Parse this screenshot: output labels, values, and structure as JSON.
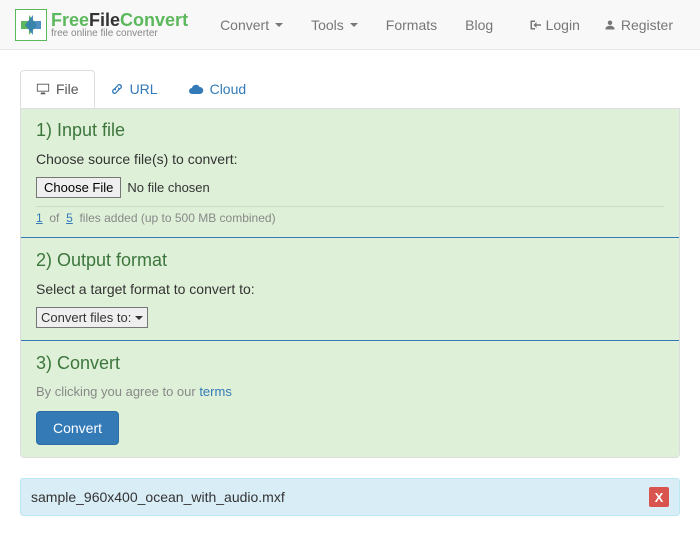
{
  "logo": {
    "line1a": "Free",
    "line1b": "File",
    "line1c": "Convert",
    "sub": "free online file converter"
  },
  "nav": {
    "convert": "Convert",
    "tools": "Tools",
    "formats": "Formats",
    "blog": "Blog",
    "login": "Login",
    "register": "Register"
  },
  "tabs": {
    "file": "File",
    "url": "URL",
    "cloud": "Cloud"
  },
  "step1": {
    "title": "1) Input file",
    "instr": "Choose source file(s) to convert:",
    "choose": "Choose File",
    "nofile": "No file chosen",
    "quota_n": "1",
    "quota_mid": "of",
    "quota_max": "5",
    "quota_rest": "files added (up to 500 MB combined)"
  },
  "step2": {
    "title": "2) Output format",
    "instr": "Select a target format to convert to:",
    "select": "Convert files to:"
  },
  "step3": {
    "title": "3) Convert",
    "terms_pre": "By clicking you agree to our ",
    "terms_link": "terms",
    "button": "Convert"
  },
  "filebar": {
    "name": "sample_960x400_ocean_with_audio.mxf",
    "close": "X"
  }
}
